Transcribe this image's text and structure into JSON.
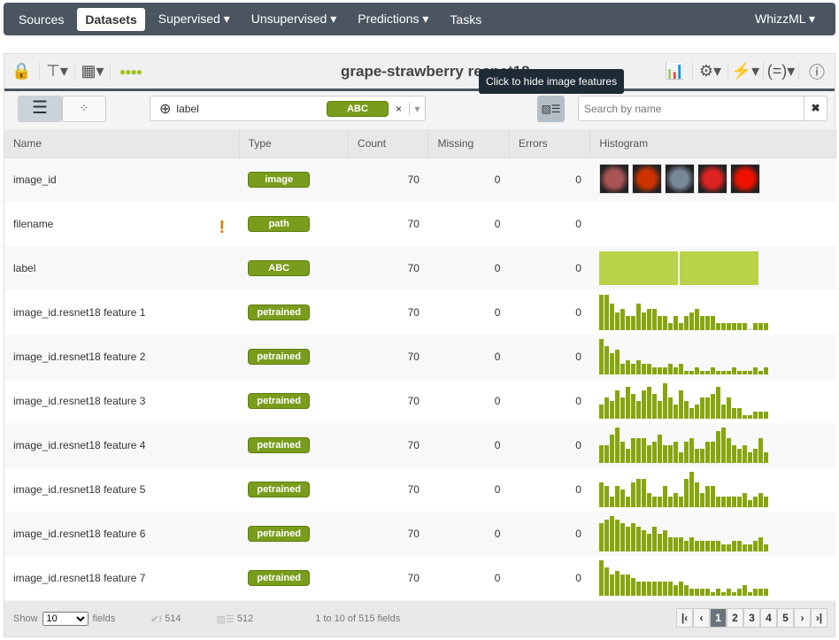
{
  "nav": {
    "items": [
      "Sources",
      "Datasets",
      "Supervised ▾",
      "Unsupervised ▾",
      "Predictions ▾",
      "Tasks"
    ],
    "active": 1,
    "user": "WhizzML ▾"
  },
  "toolbar": {
    "title": "grape-strawberry resnet18",
    "tooltip": "Click to hide image features"
  },
  "filter": {
    "objective": "label",
    "objective_type": "ABC",
    "search_placeholder": "Search by name"
  },
  "columns": [
    "Name",
    "Type",
    "Count",
    "Missing",
    "Errors",
    "Histogram"
  ],
  "rows": [
    {
      "name": "image_id",
      "type": "image",
      "count": "70",
      "missing": "0",
      "errors": "0",
      "hist": "images"
    },
    {
      "name": "filename",
      "type": "path",
      "count": "70",
      "missing": "0",
      "errors": "0",
      "hist": "none",
      "warn": "!"
    },
    {
      "name": "label",
      "type": "ABC",
      "count": "70",
      "missing": "0",
      "errors": "0",
      "hist": "categorical"
    },
    {
      "name": "image_id.resnet18 feature 1",
      "type": "petrained",
      "count": "70",
      "missing": "0",
      "errors": "0",
      "hist": [
        1,
        1,
        0.75,
        0.5,
        0.6,
        0.4,
        0.4,
        0.75,
        0.5,
        0.6,
        0.6,
        0.4,
        0.4,
        0.2,
        0.4,
        0.2,
        0.4,
        0.5,
        0.6,
        0.4,
        0.4,
        0.4,
        0.2,
        0.2,
        0.2,
        0.2,
        0.2,
        0.2,
        0.05,
        0.2,
        0.2,
        0.2
      ]
    },
    {
      "name": "image_id.resnet18 feature 2",
      "type": "petrained",
      "count": "70",
      "missing": "0",
      "errors": "0",
      "hist": [
        1,
        0.8,
        0.6,
        0.7,
        0.3,
        0.4,
        0.3,
        0.4,
        0.3,
        0.3,
        0.2,
        0.2,
        0.2,
        0.3,
        0.2,
        0.3,
        0.1,
        0.1,
        0.2,
        0.1,
        0.1,
        0.2,
        0.1,
        0.1,
        0.1,
        0.2,
        0.1,
        0.1,
        0.1,
        0.2,
        0.1,
        0.2
      ]
    },
    {
      "name": "image_id.resnet18 feature 3",
      "type": "petrained",
      "count": "70",
      "missing": "0",
      "errors": "0",
      "hist": [
        0.4,
        0.6,
        0.5,
        0.8,
        0.6,
        0.9,
        0.7,
        0.5,
        0.8,
        0.9,
        0.7,
        0.5,
        1,
        0.6,
        0.4,
        0.8,
        0.5,
        0.3,
        0.4,
        0.6,
        0.6,
        0.7,
        0.9,
        0.4,
        0.6,
        0.3,
        0.3,
        0.1,
        0.1,
        0.2,
        0.2,
        0.2
      ]
    },
    {
      "name": "image_id.resnet18 feature 4",
      "type": "petrained",
      "count": "70",
      "missing": "0",
      "errors": "0",
      "hist": [
        0.5,
        0.5,
        0.8,
        1,
        0.6,
        0.4,
        0.7,
        0.7,
        0.7,
        0.5,
        0.6,
        0.8,
        0.5,
        0.5,
        0.6,
        0.3,
        0.6,
        0.7,
        0.4,
        0.4,
        0.6,
        0.6,
        0.9,
        1,
        0.7,
        0.5,
        0.4,
        0.5,
        0.3,
        0.4,
        0.7,
        0.3
      ]
    },
    {
      "name": "image_id.resnet18 feature 5",
      "type": "petrained",
      "count": "70",
      "missing": "0",
      "errors": "0",
      "hist": [
        0.7,
        0.6,
        0.3,
        0.6,
        0.5,
        0.3,
        0.7,
        0.8,
        0.8,
        0.4,
        0.3,
        0.3,
        0.6,
        0.3,
        0.4,
        0.3,
        0.8,
        1,
        0.7,
        0.4,
        0.6,
        0.6,
        0.3,
        0.3,
        0.3,
        0.3,
        0.3,
        0.4,
        0.2,
        0.3,
        0.4,
        0.3
      ]
    },
    {
      "name": "image_id.resnet18 feature 6",
      "type": "petrained",
      "count": "70",
      "missing": "0",
      "errors": "0",
      "hist": [
        0.8,
        0.9,
        1,
        0.9,
        0.8,
        0.7,
        0.8,
        0.7,
        0.6,
        0.5,
        0.7,
        0.5,
        0.6,
        0.4,
        0.4,
        0.4,
        0.3,
        0.4,
        0.3,
        0.3,
        0.3,
        0.3,
        0.3,
        0.2,
        0.2,
        0.3,
        0.3,
        0.2,
        0.2,
        0.3,
        0.4,
        0.2
      ]
    },
    {
      "name": "image_id.resnet18 feature 7",
      "type": "petrained",
      "count": "70",
      "missing": "0",
      "errors": "0",
      "hist": [
        1,
        0.8,
        0.6,
        0.7,
        0.6,
        0.6,
        0.5,
        0.4,
        0.4,
        0.4,
        0.4,
        0.4,
        0.4,
        0.4,
        0.3,
        0.4,
        0.3,
        0.2,
        0.2,
        0.2,
        0.2,
        0.1,
        0.2,
        0.1,
        0.2,
        0.1,
        0.2,
        0.3,
        0.1,
        0.2,
        0.2,
        0.2
      ]
    }
  ],
  "footer": {
    "show": "Show",
    "page_size": "10",
    "fields": "fields",
    "valid_count": "514",
    "image_count": "512",
    "range": "1 to 10 of 515 fields",
    "pages": [
      "|‹",
      "‹",
      "1",
      "2",
      "3",
      "4",
      "5",
      "›",
      "›|"
    ],
    "current_page": "1"
  },
  "colors": {
    "nav": "#4a5560",
    "accent": "#7a9c1c",
    "hist": "#86a60f",
    "warn": "#e07b00"
  }
}
